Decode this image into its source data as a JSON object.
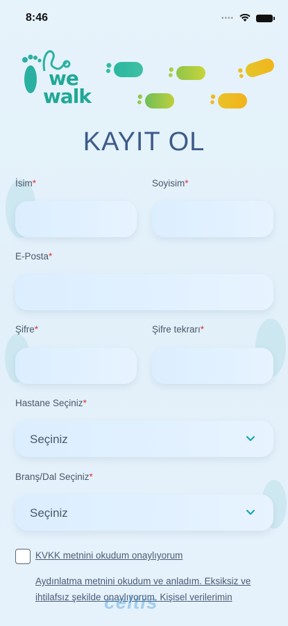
{
  "status": {
    "time": "8:46"
  },
  "brand": {
    "line1": "we",
    "line2": "walk"
  },
  "page": {
    "title": "KAYIT OL"
  },
  "fields": {
    "first_name": {
      "label": "İsim",
      "required": "*",
      "value": ""
    },
    "last_name": {
      "label": "Soyisim",
      "required": "*",
      "value": ""
    },
    "email": {
      "label": "E-Posta",
      "required": "*",
      "value": ""
    },
    "password": {
      "label": "Şifre",
      "required": "*",
      "value": ""
    },
    "password_repeat": {
      "label": "Şifre tekrarı",
      "required": "*",
      "value": ""
    },
    "hospital": {
      "label": "Hastane Seçiniz",
      "required": "*",
      "value": "Seçiniz"
    },
    "branch": {
      "label": "Branş/Dal Seçiniz",
      "required": "*",
      "value": "Seçiniz"
    }
  },
  "consent": {
    "kvkk": "KVKK metnini okudum onaylıyorum",
    "disclosure": "Aydınlatma metnini okudum ve anladım. Eksiksiz ve ihtilafsız şekilde onaylıyorum. Kişisel verilerimin"
  },
  "watermark": "celtis",
  "colors": {
    "accent": "#1fa896",
    "title": "#3d5a8a",
    "required": "#d9363e",
    "chevron": "#1aa3b5"
  }
}
